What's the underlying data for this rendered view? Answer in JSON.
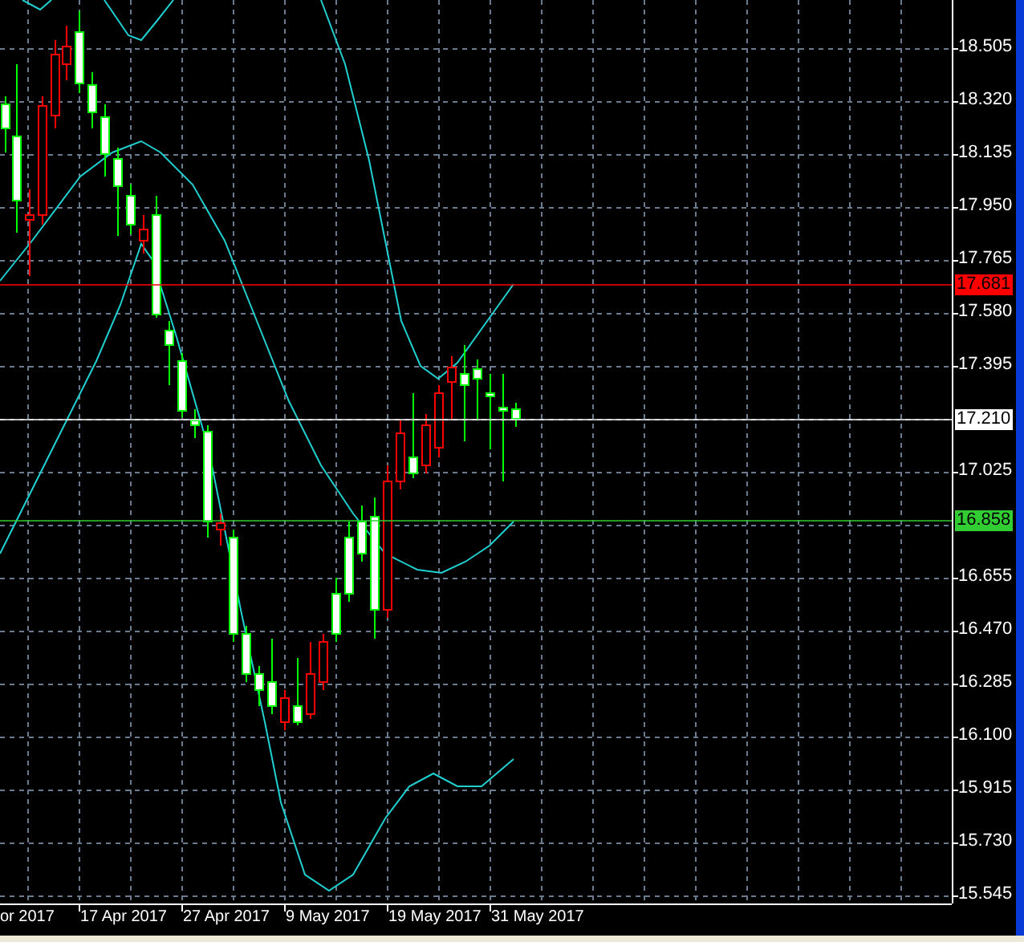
{
  "price_axis": {
    "labels": [
      "18.505",
      "18.320",
      "18.135",
      "17.950",
      "17.765",
      "17.580",
      "17.395",
      "17.025",
      "16.655",
      "16.470",
      "16.285",
      "16.100",
      "15.915",
      "15.730",
      "15.545"
    ]
  },
  "price_markers": [
    {
      "label": "17.681",
      "color": "#ff0000"
    },
    {
      "label": "17.210",
      "color": "#ffffff"
    },
    {
      "label": "16.858",
      "color": "#32cd32"
    }
  ],
  "time_axis": {
    "labels": [
      "or 2017",
      "17 Apr 2017",
      "27 Apr 2017",
      "9 May 2017",
      "19 May 2017",
      "31 May 2017"
    ]
  }
}
